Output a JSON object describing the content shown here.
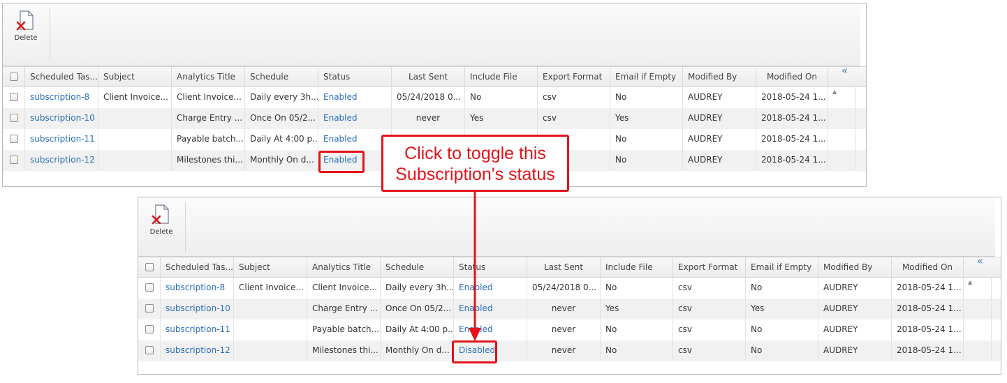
{
  "toolbar": {
    "delete_label": "Delete"
  },
  "columns": [
    "Scheduled Tas...",
    "Subject",
    "Analytics Title",
    "Schedule",
    "Status",
    "Last Sent",
    "Include File",
    "Export Format",
    "Email if Empty",
    "Modified By",
    "Modified On"
  ],
  "grid_top": {
    "rows": [
      {
        "task": "subscription-8",
        "subject": "Client Invoice...",
        "analytics": "Client Invoice...",
        "schedule": "Daily every 3h...",
        "status": "Enabled",
        "last_sent": "05/24/2018 0...",
        "include_file": "No",
        "export": "csv",
        "email_empty": "No",
        "modified_by": "AUDREY",
        "modified_on": "2018-05-24 1..."
      },
      {
        "task": "subscription-10",
        "subject": "",
        "analytics": "Charge Entry ...",
        "schedule": "Once On 05/2...",
        "status": "Enabled",
        "last_sent": "never",
        "include_file": "Yes",
        "export": "csv",
        "email_empty": "Yes",
        "modified_by": "AUDREY",
        "modified_on": "2018-05-24 1..."
      },
      {
        "task": "subscription-11",
        "subject": "",
        "analytics": "Payable batch...",
        "schedule": "Daily At 4:00 p...",
        "status": "Enabled",
        "last_sent": "",
        "include_file": "",
        "export": "",
        "email_empty": "No",
        "modified_by": "AUDREY",
        "modified_on": "2018-05-24 1..."
      },
      {
        "task": "subscription-12",
        "subject": "",
        "analytics": "Milestones thi...",
        "schedule": "Monthly On d...",
        "status": "Enabled",
        "last_sent": "",
        "include_file": "",
        "export": "",
        "email_empty": "No",
        "modified_by": "AUDREY",
        "modified_on": "2018-05-24 1..."
      }
    ]
  },
  "grid_bottom": {
    "rows": [
      {
        "task": "subscription-8",
        "subject": "Client Invoice...",
        "analytics": "Client Invoice...",
        "schedule": "Daily every 3h...",
        "status": "Enabled",
        "last_sent": "05/24/2018 0...",
        "include_file": "No",
        "export": "csv",
        "email_empty": "No",
        "modified_by": "AUDREY",
        "modified_on": "2018-05-24 1..."
      },
      {
        "task": "subscription-10",
        "subject": "",
        "analytics": "Charge Entry ...",
        "schedule": "Once On 05/2...",
        "status": "Enabled",
        "last_sent": "never",
        "include_file": "Yes",
        "export": "csv",
        "email_empty": "Yes",
        "modified_by": "AUDREY",
        "modified_on": "2018-05-24 1..."
      },
      {
        "task": "subscription-11",
        "subject": "",
        "analytics": "Payable batch...",
        "schedule": "Daily At 4:00 p...",
        "status": "Enabled",
        "last_sent": "never",
        "include_file": "No",
        "export": "csv",
        "email_empty": "No",
        "modified_by": "AUDREY",
        "modified_on": "2018-05-24 1..."
      },
      {
        "task": "subscription-12",
        "subject": "",
        "analytics": "Milestones thi...",
        "schedule": "Monthly On d...",
        "status": "Disabled",
        "last_sent": "never",
        "include_file": "No",
        "export": "csv",
        "email_empty": "No",
        "modified_by": "AUDREY",
        "modified_on": "2018-05-24 1..."
      }
    ]
  },
  "icons": {
    "collapse": "«",
    "scroll_up": "▲"
  },
  "callout": {
    "line1": "Click to toggle this",
    "line2": "Subscription's status"
  },
  "colors": {
    "link": "#2a6ebb",
    "annotation": "#e3131b"
  }
}
